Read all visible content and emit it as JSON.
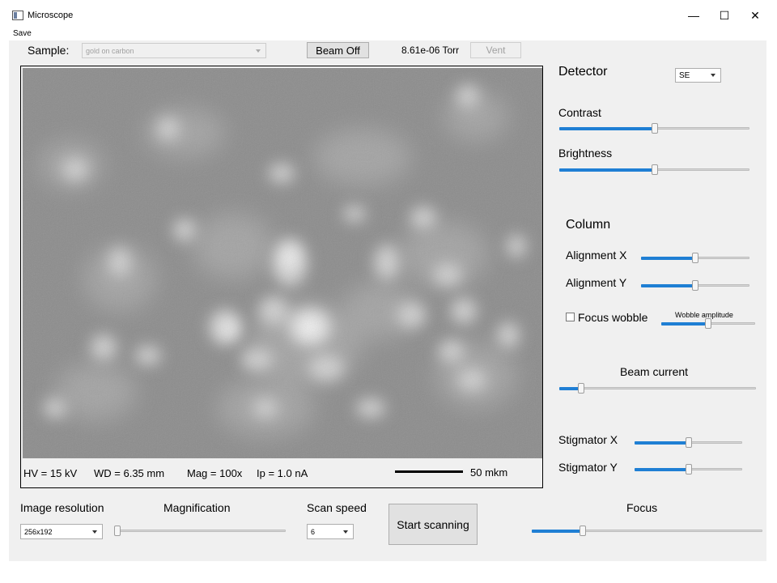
{
  "window": {
    "title": "Microscope",
    "icon": "app-window-icon",
    "controls": {
      "minimize": "—",
      "maximize": "☐",
      "close": "✕"
    }
  },
  "menu": {
    "save": "Save"
  },
  "toolbar": {
    "sample_label": "Sample:",
    "sample_value": "gold on carbon",
    "beam_button": "Beam Off",
    "pressure": "8.61e-06 Torr",
    "vent_button": "Vent"
  },
  "info_bar": {
    "hv": "HV =  15 kV",
    "wd": "WD = 6.35 mm",
    "mag": "Mag = 100x",
    "ip": "Ip = 1.0 nA",
    "scale_label": "50 mkm"
  },
  "detector": {
    "heading": "Detector",
    "value": "SE",
    "contrast_label": "Contrast",
    "contrast_level": 0.5,
    "brightness_label": "Brightness",
    "brightness_level": 0.5
  },
  "column": {
    "heading": "Column",
    "alignment_x_label": "Alignment X",
    "alignment_x_level": 0.5,
    "alignment_y_label": "Alignment Y",
    "alignment_y_level": 0.5,
    "focus_wobble_label": "Focus wobble",
    "focus_wobble_checked": false,
    "wobble_amplitude_label": "Wobble amplitude",
    "wobble_amplitude_level": 0.5
  },
  "beam": {
    "current_label": "Beam current",
    "current_level": 0.11
  },
  "stigmator": {
    "x_label": "Stigmator X",
    "x_level": 0.5,
    "y_label": "Stigmator Y",
    "y_level": 0.5
  },
  "bottom": {
    "resolution_label": "Image resolution",
    "resolution_value": "256x192",
    "magnification_label": "Magnification",
    "magnification_level": 0.0,
    "scan_speed_label": "Scan speed",
    "scan_speed_value": "6",
    "start_button": "Start scanning",
    "focus_label": "Focus",
    "focus_level": 0.22
  },
  "colors": {
    "slider_fill": "#1f7fd4",
    "panel_bg": "#f0f0f0",
    "image_base": "#8f8f8f"
  }
}
